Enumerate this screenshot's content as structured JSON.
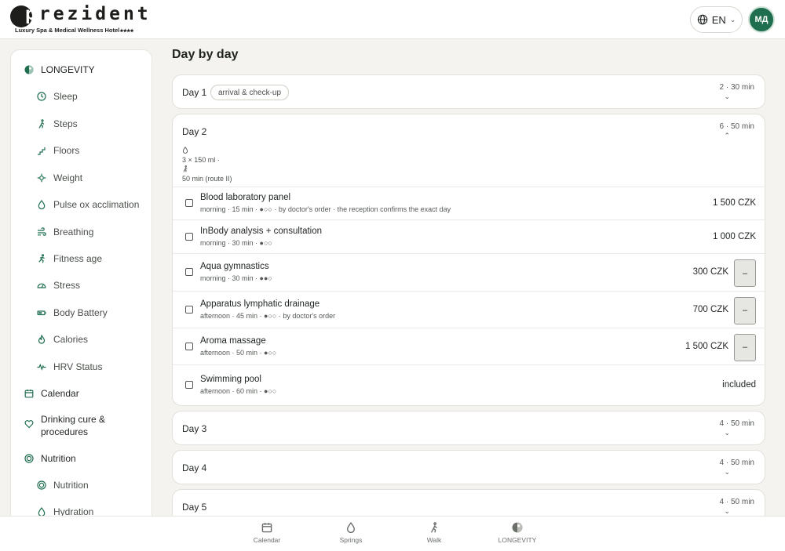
{
  "header": {
    "brand": "prezident",
    "brand_first": "p",
    "brand_rest": "rezident",
    "tagline": "Luxury Spa & Medical Wellness Hotel",
    "stars": "★★★★",
    "language": "EN",
    "avatar_initials": "МД"
  },
  "sidebar": {
    "items": [
      {
        "label": "LONGEVITY",
        "icon": "longevity-icon",
        "level": "top"
      },
      {
        "label": "Sleep",
        "icon": "clock-icon",
        "level": "sub"
      },
      {
        "label": "Steps",
        "icon": "walk-icon",
        "level": "sub"
      },
      {
        "label": "Floors",
        "icon": "stairs-icon",
        "level": "sub"
      },
      {
        "label": "Weight",
        "icon": "weight-icon",
        "level": "sub"
      },
      {
        "label": "Pulse ox acclimation",
        "icon": "drop-icon",
        "level": "sub"
      },
      {
        "label": "Breathing",
        "icon": "wind-icon",
        "level": "sub"
      },
      {
        "label": "Fitness age",
        "icon": "run-icon",
        "level": "sub"
      },
      {
        "label": "Stress",
        "icon": "gauge-icon",
        "level": "sub"
      },
      {
        "label": "Body Battery",
        "icon": "battery-icon",
        "level": "sub"
      },
      {
        "label": "Calories",
        "icon": "flame-icon",
        "level": "sub"
      },
      {
        "label": "HRV Status",
        "icon": "pulse-icon",
        "level": "sub"
      },
      {
        "label": "Calendar",
        "icon": "calendar-icon",
        "level": "top"
      },
      {
        "label": "Drinking cure & procedures",
        "icon": "heart-icon",
        "level": "top"
      },
      {
        "label": "Nutrition",
        "icon": "target-icon",
        "level": "top"
      },
      {
        "label": "Nutrition",
        "icon": "target-icon",
        "level": "sub"
      },
      {
        "label": "Hydration",
        "icon": "drop-icon",
        "level": "sub"
      }
    ]
  },
  "main": {
    "title": "Day by day",
    "days": [
      {
        "label": "Day 1",
        "tag": "arrival & check-up",
        "duration": "2 · 30 min",
        "expanded": false
      },
      {
        "label": "Day 2",
        "duration": "6 · 50 min",
        "expanded": true,
        "meta_drink": "3 × 150 ml ·",
        "meta_walk": "50 min (route II)",
        "procedures": [
          {
            "name": "Blood laboratory panel",
            "detail": "morning · 15 min · ●○○  · by doctor's order · the reception confirms the exact day",
            "price": "1 500 CZK",
            "has_remove": false
          },
          {
            "name": "InBody analysis + consultation",
            "detail": "morning · 30 min · ●○○",
            "price": "1 000 CZK",
            "has_remove": false
          },
          {
            "name": "Aqua gymnastics",
            "detail": "morning · 30 min · ●●○",
            "price": "300 CZK",
            "has_remove": true
          },
          {
            "name": "Apparatus lymphatic drainage",
            "detail": "afternoon · 45 min · ●○○  · by doctor's order",
            "price": "700 CZK",
            "has_remove": true
          },
          {
            "name": "Aroma massage",
            "detail": "afternoon · 50 min · ●○○",
            "price": "1 500 CZK",
            "has_remove": true
          },
          {
            "name": "Swimming pool",
            "detail": "afternoon · 60 min · ●○○",
            "price": "included",
            "has_remove": false
          }
        ]
      },
      {
        "label": "Day 3",
        "duration": "4 · 50 min",
        "expanded": false
      },
      {
        "label": "Day 4",
        "duration": "4 · 50 min",
        "expanded": false
      },
      {
        "label": "Day 5",
        "duration": "4 · 50 min",
        "expanded": false
      }
    ],
    "remove_label": "–",
    "chevron_down": "⌄",
    "chevron_up": "⌃"
  },
  "bottom_nav": {
    "items": [
      {
        "label": "Calendar",
        "icon": "calendar-icon"
      },
      {
        "label": "Springs",
        "icon": "drop-icon"
      },
      {
        "label": "Walk",
        "icon": "walk-icon"
      },
      {
        "label": "LONGEVITY",
        "icon": "longevity-icon"
      }
    ]
  },
  "colors": {
    "accent": "#1e6e4f",
    "background": "#f4f3ef",
    "card": "#ffffff"
  }
}
